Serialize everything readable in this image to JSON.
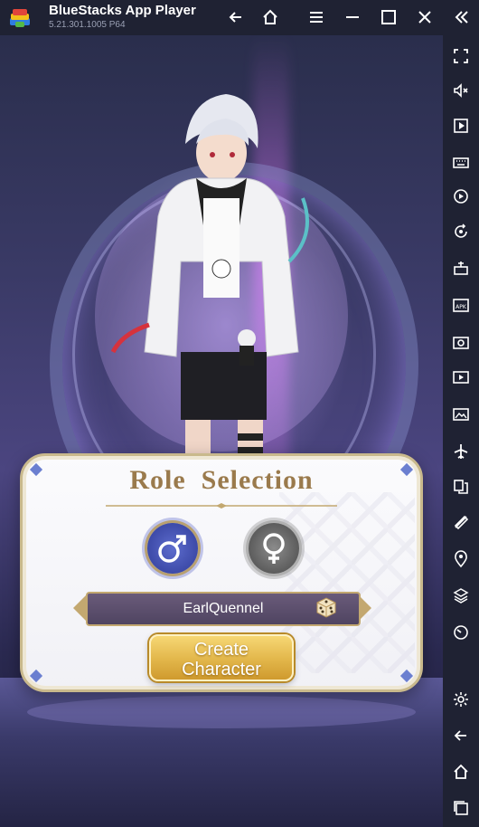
{
  "window": {
    "title": "BlueStacks App Player",
    "version": "5.21.301.1005  P64"
  },
  "titlebar_icons": [
    "back-icon",
    "home-icon",
    "menu-icon",
    "minimize-icon",
    "maximize-icon",
    "close-icon",
    "collapse-sidebar-icon"
  ],
  "sidebar_icons": [
    "fullscreen-icon",
    "volume-mute-icon",
    "media-play-icon",
    "keyboard-icon",
    "record-icon",
    "rotate-icon",
    "gamepad-controls-icon",
    "install-apk-icon",
    "screenshot-icon",
    "screen-record-icon",
    "media-folder-icon",
    "airplane-mode-icon",
    "multi-instance-icon",
    "eco-mode-icon",
    "location-icon",
    "layers-icon",
    "performance-icon",
    "settings-icon",
    "android-back-icon",
    "android-home-icon",
    "recent-apps-icon"
  ],
  "panel": {
    "title": "Role  Selection",
    "selected_gender": "male",
    "character_name": "EarlQuennel",
    "create_button": "Create\nCharacter"
  },
  "colors": {
    "accent_gold": "#c3a870",
    "male_blue": "#3d4aa8",
    "button_gold": "#e2b64a"
  }
}
